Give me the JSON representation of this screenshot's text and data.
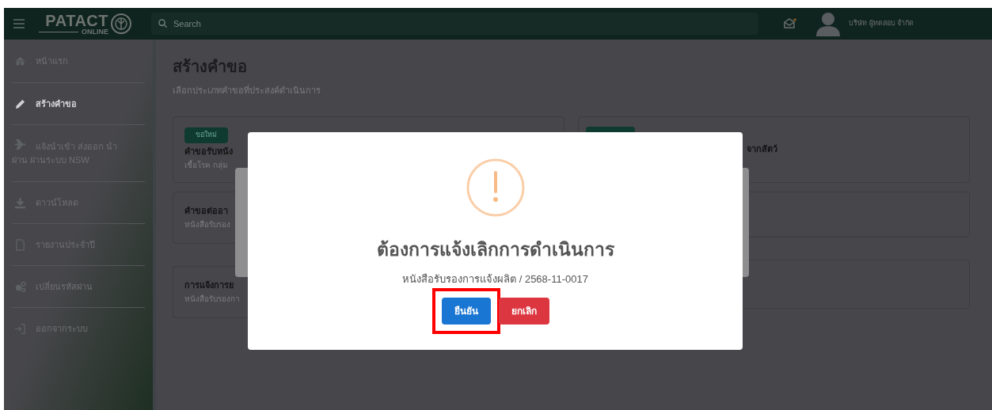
{
  "header": {
    "logo": {
      "title": "PATACT",
      "subtitle": "ONLINE"
    },
    "search": {
      "placeholder": "Search"
    },
    "user_name": "บริษัท ผู้ทดสอบ จำกัด"
  },
  "sidebar": {
    "items": [
      {
        "label": "หน้าแรก",
        "selected": false
      },
      {
        "label": "สร้างคำขอ",
        "selected": true
      },
      {
        "label": "แจ้งนำเข้า ส่งออก นำผ่าน ผ่านระบบ NSW",
        "selected": false
      },
      {
        "label": "ดาวน์โหลด",
        "selected": false
      },
      {
        "label": "รายงานประจำปี",
        "selected": false
      },
      {
        "label": "เปลี่ยนรหัสผ่าน",
        "selected": false
      },
      {
        "label": "ออกจากระบบ",
        "selected": false
      }
    ]
  },
  "page": {
    "title": "สร้างคำขอ",
    "subtitle": "เลือกประเภทคำขอที่ประสงค์ดำเนินการ",
    "cards_left": [
      {
        "badge": "ขอใหม่",
        "title": "คำขอรับหนัง",
        "description": "เชื้อโรค กลุ่ม"
      },
      {
        "title": "คำขอต่ออา",
        "description": "หนังสือรับรอง"
      },
      {
        "title": "การแจ้งการย",
        "description": "หนังสือรับรองกา"
      }
    ],
    "cards_right": [
      {
        "title": "จากสัตว์"
      }
    ]
  },
  "dialog": {
    "title": "ต้องการแจ้งเลิกการดำเนินการ",
    "message": "หนังสือรับรองการแจ้งผลิต / 2568-11-0017",
    "buttons": [
      {
        "label": "ยืนยัน",
        "kind": "confirm",
        "highlighted": true
      },
      {
        "label": "ยกเลิก",
        "kind": "cancel",
        "highlighted": false
      }
    ]
  }
}
